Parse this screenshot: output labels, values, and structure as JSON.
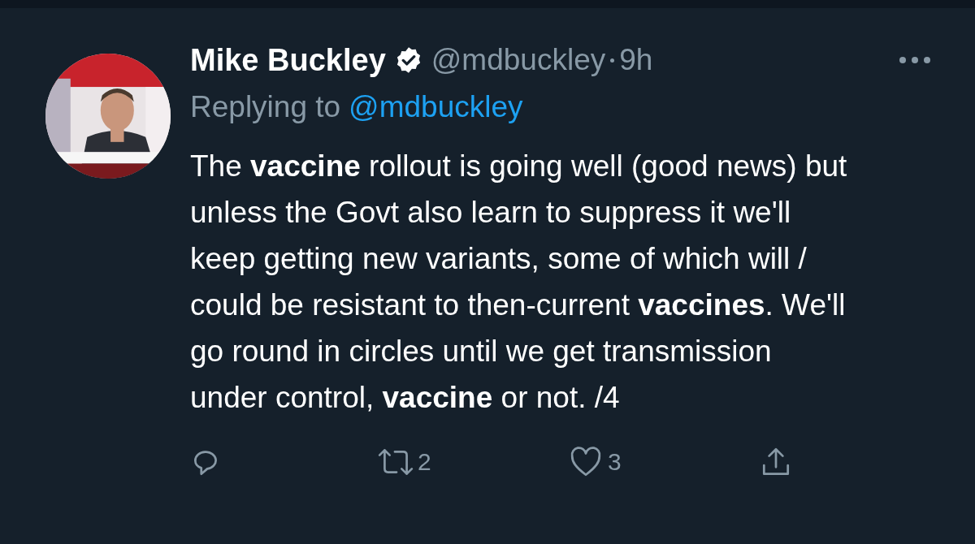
{
  "tweet": {
    "author": {
      "name": "Mike Buckley",
      "verified": true,
      "handle": "@mdbuckley",
      "time": "9h"
    },
    "reply_prefix": "Replying to",
    "reply_to": "@mdbuckley",
    "text": "The **vaccine** rollout is going well (good news) but unless the Govt also learn to suppress it we'll keep getting new variants, some of which will / could be resistant to then-current **vaccines**. We'll go round in circles until we get transmission under control, **vaccine** or not. /4",
    "actions": [
      {
        "kind": "reply"
      },
      {
        "kind": "retweet",
        "count": "2"
      },
      {
        "kind": "like",
        "count": "3"
      },
      {
        "kind": "share"
      }
    ]
  }
}
